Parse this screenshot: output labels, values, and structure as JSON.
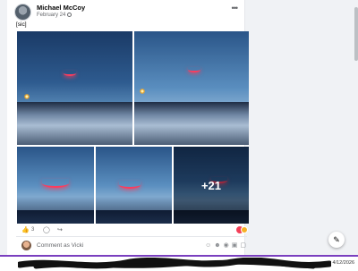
{
  "post": {
    "author": "Michael McCoy",
    "date": "February 24",
    "caption": "[sic]",
    "more_menu": "•••",
    "more_photos": "+21"
  },
  "actions": {
    "like_icon": "thumbs-up-icon",
    "like_count": "3",
    "comment_icon": "comment-icon",
    "share_icon": "share-icon",
    "reactions": [
      "love",
      "haha"
    ]
  },
  "comment": {
    "placeholder": "Comment as Vicki",
    "icons": [
      "sticker-icon",
      "emoji-icon",
      "camera-icon",
      "gif-icon",
      "sticker-alt-icon"
    ]
  },
  "fab": {
    "icon": "compose-icon"
  },
  "taskbar": {
    "clock": "4/12/2026"
  },
  "colors": {
    "accent": "#7a3fbf",
    "arc": "#ff3b5c",
    "love": "#f33e58",
    "haha": "#f7b125"
  }
}
